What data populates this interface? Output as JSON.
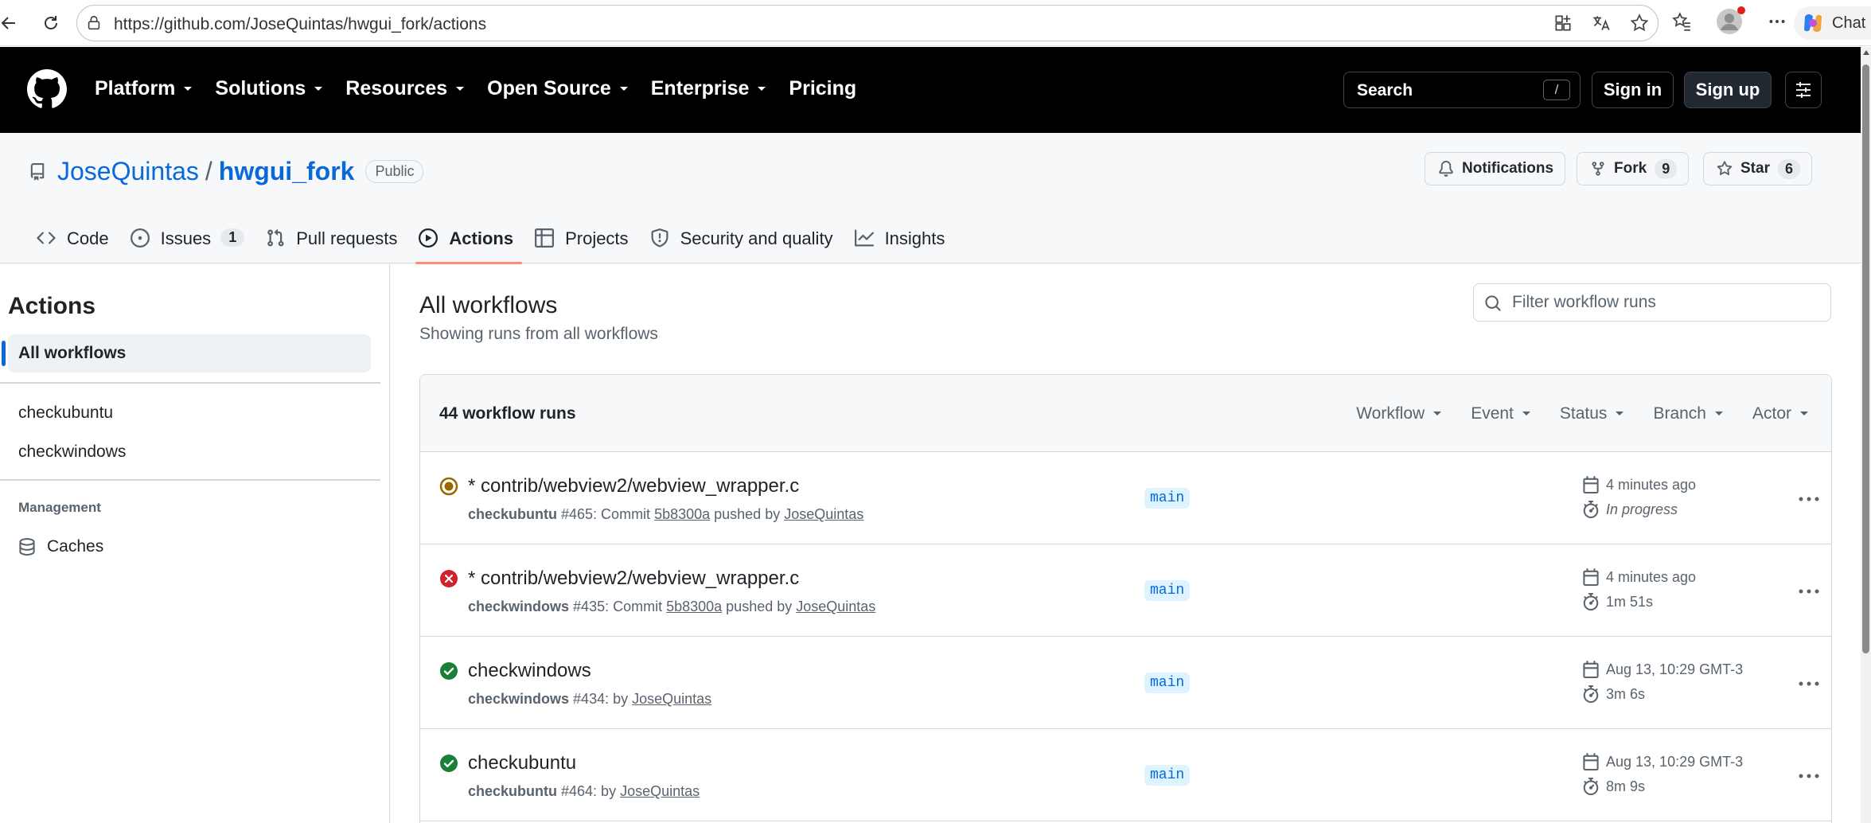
{
  "browser": {
    "url": "https://github.com/JoseQuintas/hwgui_fork/actions",
    "chat_label": "Chat"
  },
  "header": {
    "nav": [
      "Platform",
      "Solutions",
      "Resources",
      "Open Source",
      "Enterprise",
      "Pricing"
    ],
    "search_placeholder": "Search",
    "search_key": "/",
    "signin": "Sign in",
    "signup": "Sign up"
  },
  "repo": {
    "owner": "JoseQuintas",
    "slash": "/",
    "name": "hwgui_fork",
    "visibility": "Public",
    "notifications": "Notifications",
    "fork_label": "Fork",
    "fork_count": "9",
    "star_label": "Star",
    "star_count": "6",
    "tabs": [
      {
        "label": "Code",
        "icon": "code-icon"
      },
      {
        "label": "Issues",
        "count": "1",
        "icon": "issue-icon"
      },
      {
        "label": "Pull requests",
        "icon": "pull-request-icon"
      },
      {
        "label": "Actions",
        "icon": "play-icon",
        "active": true
      },
      {
        "label": "Projects",
        "icon": "table-icon"
      },
      {
        "label": "Security and quality",
        "icon": "shield-icon"
      },
      {
        "label": "Insights",
        "icon": "graph-icon"
      }
    ]
  },
  "sidebar": {
    "title": "Actions",
    "all_workflows": "All workflows",
    "workflows": [
      "checkubuntu",
      "checkwindows"
    ],
    "management_heading": "Management",
    "caches": "Caches"
  },
  "main": {
    "title": "All workflows",
    "subtitle": "Showing runs from all workflows",
    "filter_placeholder": "Filter workflow runs",
    "runs_count": "44 workflow runs",
    "filters": [
      "Workflow",
      "Event",
      "Status",
      "Branch",
      "Actor"
    ],
    "runs": [
      {
        "status": "in-progress",
        "title": "* contrib/webview2/webview_wrapper.c",
        "workflow": "checkubuntu",
        "meta_mid": " #465: Commit ",
        "commit": "5b8300a",
        "meta_tail": " pushed by ",
        "actor": "JoseQuintas",
        "branch": "main",
        "time": "4 minutes ago",
        "duration": "In progress"
      },
      {
        "status": "failure",
        "title": "* contrib/webview2/webview_wrapper.c",
        "workflow": "checkwindows",
        "meta_mid": " #435: Commit ",
        "commit": "5b8300a",
        "meta_tail": " pushed by ",
        "actor": "JoseQuintas",
        "branch": "main",
        "time": "4 minutes ago",
        "duration": "1m 51s"
      },
      {
        "status": "success",
        "title": "checkwindows",
        "workflow": "checkwindows",
        "meta_mid": " #434: by ",
        "actor": "JoseQuintas",
        "branch": "main",
        "time": "Aug 13, 10:29 GMT-3",
        "duration": "3m 6s"
      },
      {
        "status": "success",
        "title": "checkubuntu",
        "workflow": "checkubuntu",
        "meta_mid": " #464: by ",
        "actor": "JoseQuintas",
        "branch": "main",
        "time": "Aug 13, 10:29 GMT-3",
        "duration": "8m 9s"
      }
    ]
  },
  "colors": {
    "accent": "#0969da",
    "tab_underline": "#fd8c73",
    "success": "#1a7f37",
    "failure": "#cf222e",
    "in_progress": "#9a6700"
  }
}
